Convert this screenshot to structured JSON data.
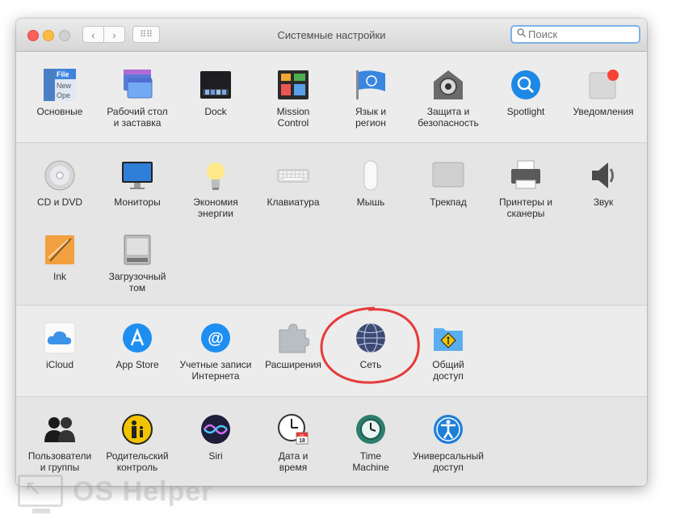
{
  "window": {
    "title": "Системные настройки"
  },
  "search": {
    "placeholder": "Поиск"
  },
  "watermark": {
    "text": "OS Helper"
  },
  "sections": [
    {
      "panes": [
        {
          "label": "Основные",
          "icon": "general-icon"
        },
        {
          "label": "Рабочий стол\nи заставка",
          "icon": "desktop-screensaver-icon"
        },
        {
          "label": "Dock",
          "icon": "dock-icon"
        },
        {
          "label": "Mission\nControl",
          "icon": "mission-control-icon"
        },
        {
          "label": "Язык и\nрегион",
          "icon": "language-region-icon"
        },
        {
          "label": "Защита и\nбезопасность",
          "icon": "security-icon"
        },
        {
          "label": "Spotlight",
          "icon": "spotlight-icon"
        },
        {
          "label": "Уведомления",
          "icon": "notifications-icon"
        }
      ]
    },
    {
      "panes": [
        {
          "label": "CD и DVD",
          "icon": "cd-dvd-icon"
        },
        {
          "label": "Мониторы",
          "icon": "displays-icon"
        },
        {
          "label": "Экономия\nэнергии",
          "icon": "energy-saver-icon"
        },
        {
          "label": "Клавиатура",
          "icon": "keyboard-icon"
        },
        {
          "label": "Мышь",
          "icon": "mouse-icon"
        },
        {
          "label": "Трекпад",
          "icon": "trackpad-icon"
        },
        {
          "label": "Принтеры и\nсканеры",
          "icon": "printers-icon"
        },
        {
          "label": "Звук",
          "icon": "sound-icon"
        },
        {
          "label": "Ink",
          "icon": "ink-icon"
        },
        {
          "label": "Загрузочный\nтом",
          "icon": "startup-disk-icon"
        }
      ]
    },
    {
      "panes": [
        {
          "label": "iCloud",
          "icon": "icloud-icon"
        },
        {
          "label": "App Store",
          "icon": "app-store-icon"
        },
        {
          "label": "Учетные записи\nИнтернета",
          "icon": "internet-accounts-icon"
        },
        {
          "label": "Расширения",
          "icon": "extensions-icon"
        },
        {
          "label": "Сеть",
          "icon": "network-icon"
        },
        {
          "label": "Общий\nдоступ",
          "icon": "sharing-icon"
        }
      ]
    },
    {
      "panes": [
        {
          "label": "Пользователи\nи группы",
          "icon": "users-groups-icon"
        },
        {
          "label": "Родительский\nконтроль",
          "icon": "parental-controls-icon"
        },
        {
          "label": "Siri",
          "icon": "siri-icon"
        },
        {
          "label": "Дата и\nвремя",
          "icon": "date-time-icon"
        },
        {
          "label": "Time\nMachine",
          "icon": "time-machine-icon"
        },
        {
          "label": "Универсальный\nдоступ",
          "icon": "accessibility-icon"
        }
      ]
    }
  ],
  "icon_text": {
    "general_file": "File",
    "general_new": "New",
    "general_open": "Ope",
    "calendar_month": "JUL",
    "calendar_day": "18"
  }
}
